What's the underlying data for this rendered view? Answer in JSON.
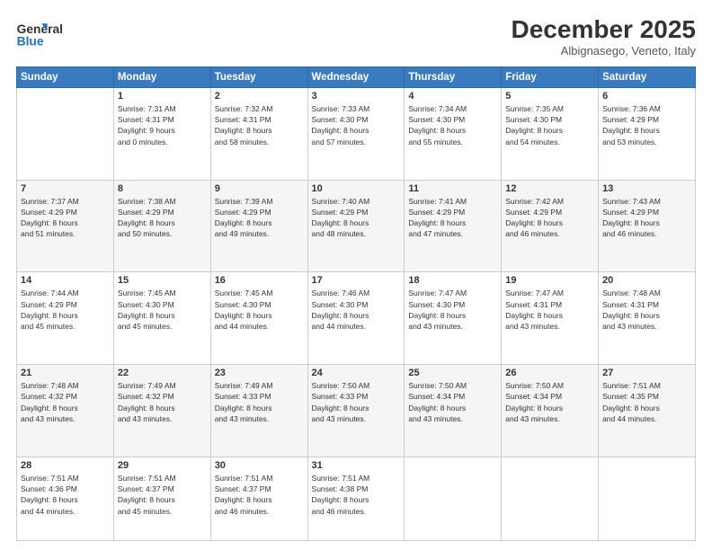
{
  "logo": {
    "line1": "General",
    "line2": "Blue"
  },
  "header": {
    "month": "December 2025",
    "location": "Albignasego, Veneto, Italy"
  },
  "days_of_week": [
    "Sunday",
    "Monday",
    "Tuesday",
    "Wednesday",
    "Thursday",
    "Friday",
    "Saturday"
  ],
  "weeks": [
    [
      {
        "day": "",
        "info": ""
      },
      {
        "day": "1",
        "info": "Sunrise: 7:31 AM\nSunset: 4:31 PM\nDaylight: 9 hours\nand 0 minutes."
      },
      {
        "day": "2",
        "info": "Sunrise: 7:32 AM\nSunset: 4:31 PM\nDaylight: 8 hours\nand 58 minutes."
      },
      {
        "day": "3",
        "info": "Sunrise: 7:33 AM\nSunset: 4:30 PM\nDaylight: 8 hours\nand 57 minutes."
      },
      {
        "day": "4",
        "info": "Sunrise: 7:34 AM\nSunset: 4:30 PM\nDaylight: 8 hours\nand 55 minutes."
      },
      {
        "day": "5",
        "info": "Sunrise: 7:35 AM\nSunset: 4:30 PM\nDaylight: 8 hours\nand 54 minutes."
      },
      {
        "day": "6",
        "info": "Sunrise: 7:36 AM\nSunset: 4:29 PM\nDaylight: 8 hours\nand 53 minutes."
      }
    ],
    [
      {
        "day": "7",
        "info": "Sunrise: 7:37 AM\nSunset: 4:29 PM\nDaylight: 8 hours\nand 51 minutes."
      },
      {
        "day": "8",
        "info": "Sunrise: 7:38 AM\nSunset: 4:29 PM\nDaylight: 8 hours\nand 50 minutes."
      },
      {
        "day": "9",
        "info": "Sunrise: 7:39 AM\nSunset: 4:29 PM\nDaylight: 8 hours\nand 49 minutes."
      },
      {
        "day": "10",
        "info": "Sunrise: 7:40 AM\nSunset: 4:29 PM\nDaylight: 8 hours\nand 48 minutes."
      },
      {
        "day": "11",
        "info": "Sunrise: 7:41 AM\nSunset: 4:29 PM\nDaylight: 8 hours\nand 47 minutes."
      },
      {
        "day": "12",
        "info": "Sunrise: 7:42 AM\nSunset: 4:29 PM\nDaylight: 8 hours\nand 46 minutes."
      },
      {
        "day": "13",
        "info": "Sunrise: 7:43 AM\nSunset: 4:29 PM\nDaylight: 8 hours\nand 46 minutes."
      }
    ],
    [
      {
        "day": "14",
        "info": "Sunrise: 7:44 AM\nSunset: 4:29 PM\nDaylight: 8 hours\nand 45 minutes."
      },
      {
        "day": "15",
        "info": "Sunrise: 7:45 AM\nSunset: 4:30 PM\nDaylight: 8 hours\nand 45 minutes."
      },
      {
        "day": "16",
        "info": "Sunrise: 7:45 AM\nSunset: 4:30 PM\nDaylight: 8 hours\nand 44 minutes."
      },
      {
        "day": "17",
        "info": "Sunrise: 7:46 AM\nSunset: 4:30 PM\nDaylight: 8 hours\nand 44 minutes."
      },
      {
        "day": "18",
        "info": "Sunrise: 7:47 AM\nSunset: 4:30 PM\nDaylight: 8 hours\nand 43 minutes."
      },
      {
        "day": "19",
        "info": "Sunrise: 7:47 AM\nSunset: 4:31 PM\nDaylight: 8 hours\nand 43 minutes."
      },
      {
        "day": "20",
        "info": "Sunrise: 7:48 AM\nSunset: 4:31 PM\nDaylight: 8 hours\nand 43 minutes."
      }
    ],
    [
      {
        "day": "21",
        "info": "Sunrise: 7:48 AM\nSunset: 4:32 PM\nDaylight: 8 hours\nand 43 minutes."
      },
      {
        "day": "22",
        "info": "Sunrise: 7:49 AM\nSunset: 4:32 PM\nDaylight: 8 hours\nand 43 minutes."
      },
      {
        "day": "23",
        "info": "Sunrise: 7:49 AM\nSunset: 4:33 PM\nDaylight: 8 hours\nand 43 minutes."
      },
      {
        "day": "24",
        "info": "Sunrise: 7:50 AM\nSunset: 4:33 PM\nDaylight: 8 hours\nand 43 minutes."
      },
      {
        "day": "25",
        "info": "Sunrise: 7:50 AM\nSunset: 4:34 PM\nDaylight: 8 hours\nand 43 minutes."
      },
      {
        "day": "26",
        "info": "Sunrise: 7:50 AM\nSunset: 4:34 PM\nDaylight: 8 hours\nand 43 minutes."
      },
      {
        "day": "27",
        "info": "Sunrise: 7:51 AM\nSunset: 4:35 PM\nDaylight: 8 hours\nand 44 minutes."
      }
    ],
    [
      {
        "day": "28",
        "info": "Sunrise: 7:51 AM\nSunset: 4:36 PM\nDaylight: 8 hours\nand 44 minutes."
      },
      {
        "day": "29",
        "info": "Sunrise: 7:51 AM\nSunset: 4:37 PM\nDaylight: 8 hours\nand 45 minutes."
      },
      {
        "day": "30",
        "info": "Sunrise: 7:51 AM\nSunset: 4:37 PM\nDaylight: 8 hours\nand 46 minutes."
      },
      {
        "day": "31",
        "info": "Sunrise: 7:51 AM\nSunset: 4:38 PM\nDaylight: 8 hours\nand 46 minutes."
      },
      {
        "day": "",
        "info": ""
      },
      {
        "day": "",
        "info": ""
      },
      {
        "day": "",
        "info": ""
      }
    ]
  ]
}
